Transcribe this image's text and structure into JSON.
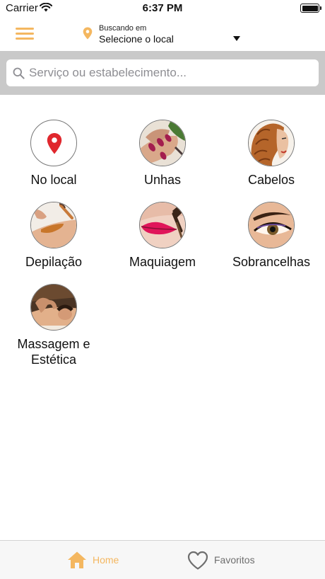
{
  "status_bar": {
    "carrier": "Carrier",
    "time": "6:37 PM",
    "battery_level": 1.0
  },
  "header": {
    "menu_icon": "hamburger-icon",
    "location_icon": "map-pin-icon",
    "location_caption": "Buscando em",
    "location_value": "Selecione o local"
  },
  "search": {
    "placeholder": "Serviço ou estabelecimento...",
    "value": ""
  },
  "categories": [
    {
      "label": "No local",
      "icon": "map-pin-icon"
    },
    {
      "label": "Unhas",
      "icon": "nails-photo"
    },
    {
      "label": "Cabelos",
      "icon": "hair-photo"
    },
    {
      "label": "Depilação",
      "icon": "waxing-photo"
    },
    {
      "label": "Maquiagem",
      "icon": "makeup-photo"
    },
    {
      "label": "Sobrancelhas",
      "icon": "eyebrow-photo"
    },
    {
      "label": "Massagem e Estética",
      "icon": "massage-photo"
    }
  ],
  "tab_bar": {
    "items": [
      {
        "label": "Home",
        "icon": "home-icon",
        "active": true
      },
      {
        "label": "Favoritos",
        "icon": "heart-icon",
        "active": false
      }
    ]
  },
  "colors": {
    "accent": "#f4b760",
    "pin_red": "#e0282e",
    "search_band": "#c9c9c9",
    "inactive": "#6e6e6e"
  }
}
